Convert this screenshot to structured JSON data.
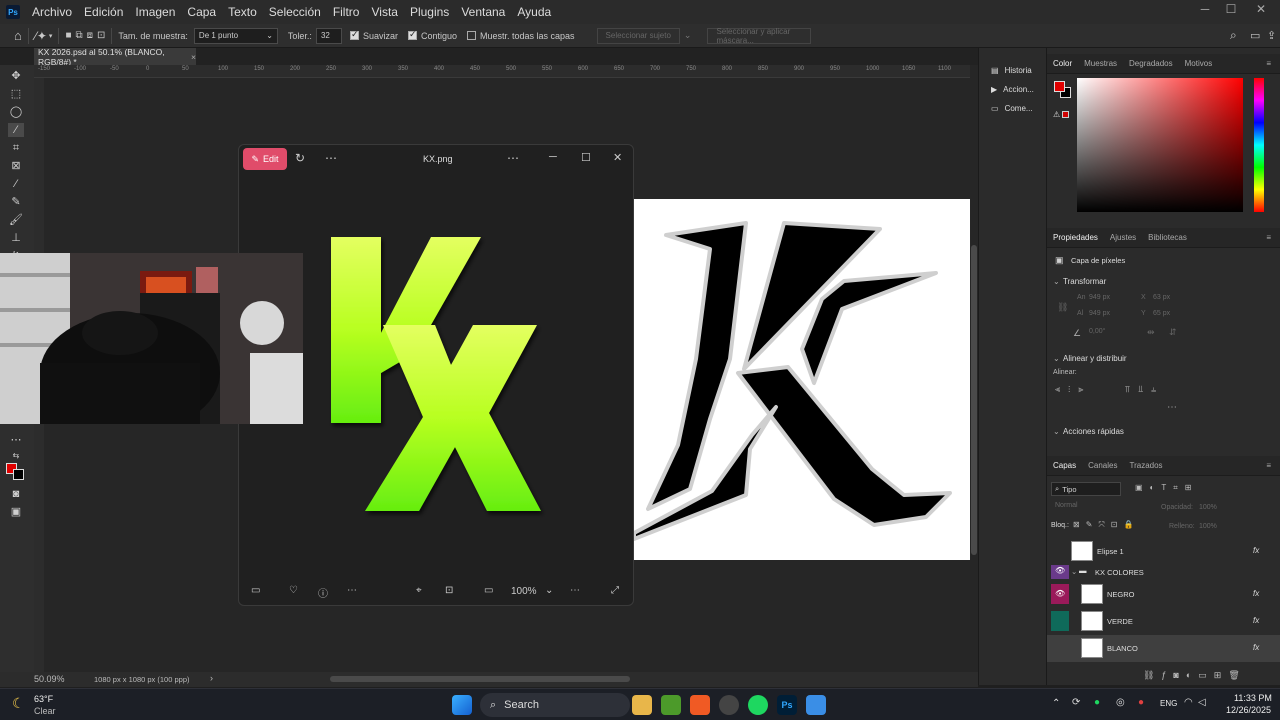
{
  "menubar": {
    "logo": "Ps",
    "items": [
      "Archivo",
      "Edición",
      "Imagen",
      "Capa",
      "Texto",
      "Selección",
      "Filtro",
      "Vista",
      "Plugins",
      "Ventana",
      "Ayuda"
    ]
  },
  "options": {
    "sample_size_label": "Tam. de muestra:",
    "sample_size_value": "De 1 punto",
    "tolerance_label": "Toler.:",
    "tolerance_value": "32",
    "smooth_label": "Suavizar",
    "contiguous_label": "Contiguo",
    "all_layers_label": "Muestr. todas las capas",
    "select_subject": "Seleccionar sujeto",
    "select_mask": "Seleccionar y aplicar máscara..."
  },
  "document": {
    "tab_title": "KX 2026.psd al 50.1% (BLANCO, RGB/8#) *",
    "zoom": "50.09%",
    "size_info": "1080 px x 1080 px (100 ppp)",
    "ruler_ticks": [
      "-150",
      "-100",
      "-50",
      "0",
      "50",
      "100",
      "150",
      "200",
      "250",
      "300",
      "350",
      "400",
      "450",
      "500",
      "550",
      "600",
      "650",
      "700",
      "750",
      "800",
      "850",
      "900",
      "950",
      "1000",
      "1050",
      "1100"
    ]
  },
  "minipanel": {
    "items": [
      "Historia",
      "Accion...",
      "Come..."
    ]
  },
  "color_panel": {
    "tabs": [
      "Color",
      "Muestras",
      "Degradados",
      "Motivos"
    ],
    "foreground": "#e00000",
    "background": "#000000"
  },
  "properties_panel": {
    "tabs": [
      "Propiedades",
      "Ajustes",
      "Bibliotecas"
    ],
    "pixel_layer": "Capa de píxeles",
    "transform": "Transformar",
    "w_label": "An",
    "w_value": "949 px",
    "x_label": "X",
    "x_value": "63 px",
    "h_label": "Al",
    "h_value": "949 px",
    "y_label": "Y",
    "y_value": "65 px",
    "angle": "0,00°",
    "align": "Alinear y distribuir",
    "align_sub": "Alinear:",
    "quick": "Acciones rápidas"
  },
  "layers_panel": {
    "tabs": [
      "Capas",
      "Canales",
      "Trazados"
    ],
    "filter": "Tipo",
    "blend": "Normal",
    "opacity_label": "Opacidad:",
    "opacity": "100%",
    "lock_label": "Bloq.:",
    "fill_label": "Relleno:",
    "fill": "100%",
    "layers": [
      {
        "name": "Elipse 1",
        "visible": false,
        "eye_color": ""
      },
      {
        "name": "KX COLORES",
        "visible": true,
        "eye_color": "#6a3a8a"
      },
      {
        "name": "NEGRO",
        "visible": true,
        "eye_color": "#9a1a5a"
      },
      {
        "name": "VERDE",
        "visible": false,
        "eye_color": "#0f6a5a"
      },
      {
        "name": "BLANCO",
        "visible": false,
        "eye_color": ""
      }
    ]
  },
  "viewer": {
    "edit_label": "Edit",
    "title": "KX.png",
    "zoom": "100%"
  },
  "taskbar": {
    "temp": "63°F",
    "weather": "Clear",
    "search": "Search",
    "lang": "ENG",
    "time": "11:33 PM",
    "date": "12/26/2025"
  },
  "colors": {
    "accent_edit": "#e04c6a",
    "kx_green_top": "#d8ff4a",
    "kx_green_bottom": "#6ef010"
  }
}
